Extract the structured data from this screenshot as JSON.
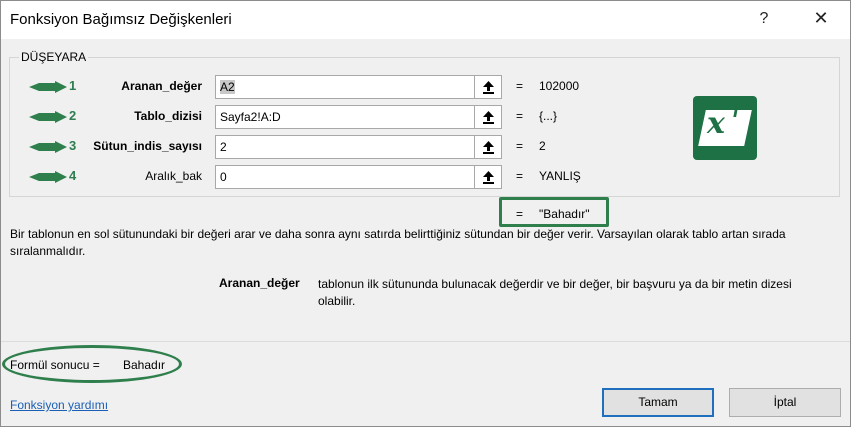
{
  "window": {
    "title": "Fonksiyon Bağımsız Değişkenleri",
    "help_glyph": "?",
    "close_glyph": "✕"
  },
  "function": {
    "name": "DÜŞEYARA",
    "args": [
      {
        "number": "1",
        "label": "Aranan_değer",
        "bold": true,
        "value": "A2",
        "result": "102000"
      },
      {
        "number": "2",
        "label": "Tablo_dizisi",
        "bold": true,
        "value": "Sayfa2!A:D",
        "result": "{...}"
      },
      {
        "number": "3",
        "label": "Sütun_indis_sayısı",
        "bold": true,
        "value": "2",
        "result": "2"
      },
      {
        "number": "4",
        "label": "Aralık_bak",
        "bold": false,
        "value": "0",
        "result": "YANLIŞ"
      }
    ],
    "equals": "=",
    "final_result": "\"Bahadır\""
  },
  "description": {
    "main": "Bir tablonun en sol sütunundaki bir değeri arar ve daha sonra aynı satırda belirttiğiniz sütundan bir değer verir. Varsayılan olarak tablo artan sırada sıralanmalıdır.",
    "arg_name": "Aranan_değer",
    "arg_text": "tablonun ilk sütununda bulunacak değerdir ve bir değer, bir başvuru ya da bir metin dizesi olabilir."
  },
  "formula_result": {
    "label": "Formül sonucu =",
    "value": "Bahadır"
  },
  "footer": {
    "help_link": "Fonksiyon yardımı",
    "ok_label": "Tamam",
    "cancel_label": "İptal"
  },
  "colors": {
    "annotation_green": "#2f7f4d",
    "excel_green": "#1e7145",
    "link_blue": "#1a5fb4"
  },
  "icons": {
    "ref_button": "collapse-dialog-arrow-icon",
    "logo": "excel-logo-icon",
    "annotation": "green-arrow-icon"
  }
}
